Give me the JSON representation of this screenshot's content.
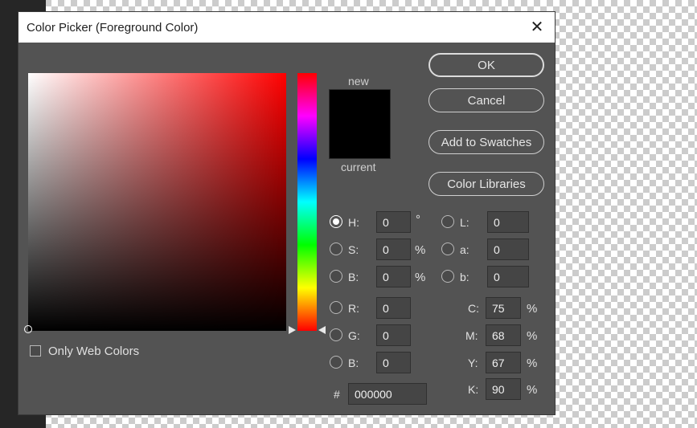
{
  "dialog": {
    "title": "Color Picker (Foreground Color)",
    "close_glyph": "✕"
  },
  "swatch": {
    "new_label": "new",
    "current_label": "current",
    "new_color": "#000000",
    "current_color": "#000000"
  },
  "buttons": {
    "ok": "OK",
    "cancel": "Cancel",
    "add_to_swatches": "Add to Swatches",
    "color_libraries": "Color Libraries"
  },
  "hsb": {
    "h_label": "H:",
    "h_value": "0",
    "h_unit": "°",
    "s_label": "S:",
    "s_value": "0",
    "s_unit": "%",
    "b_label": "B:",
    "b_value": "0",
    "b_unit": "%",
    "selected": "H"
  },
  "lab": {
    "l_label": "L:",
    "l_value": "0",
    "a_label": "a:",
    "a_value": "0",
    "b_label": "b:",
    "b_value": "0"
  },
  "rgb": {
    "r_label": "R:",
    "r_value": "0",
    "g_label": "G:",
    "g_value": "0",
    "b_label": "B:",
    "b_value": "0"
  },
  "cmyk": {
    "c_label": "C:",
    "c_value": "75",
    "m_label": "M:",
    "m_value": "68",
    "y_label": "Y:",
    "y_value": "67",
    "k_label": "K:",
    "k_value": "90",
    "unit": "%"
  },
  "hex": {
    "label": "#",
    "value": "000000"
  },
  "web_colors": {
    "label": "Only Web Colors",
    "checked": false
  },
  "colors": {
    "dialog_bg": "#535353",
    "hue_base": "#ff0000"
  }
}
